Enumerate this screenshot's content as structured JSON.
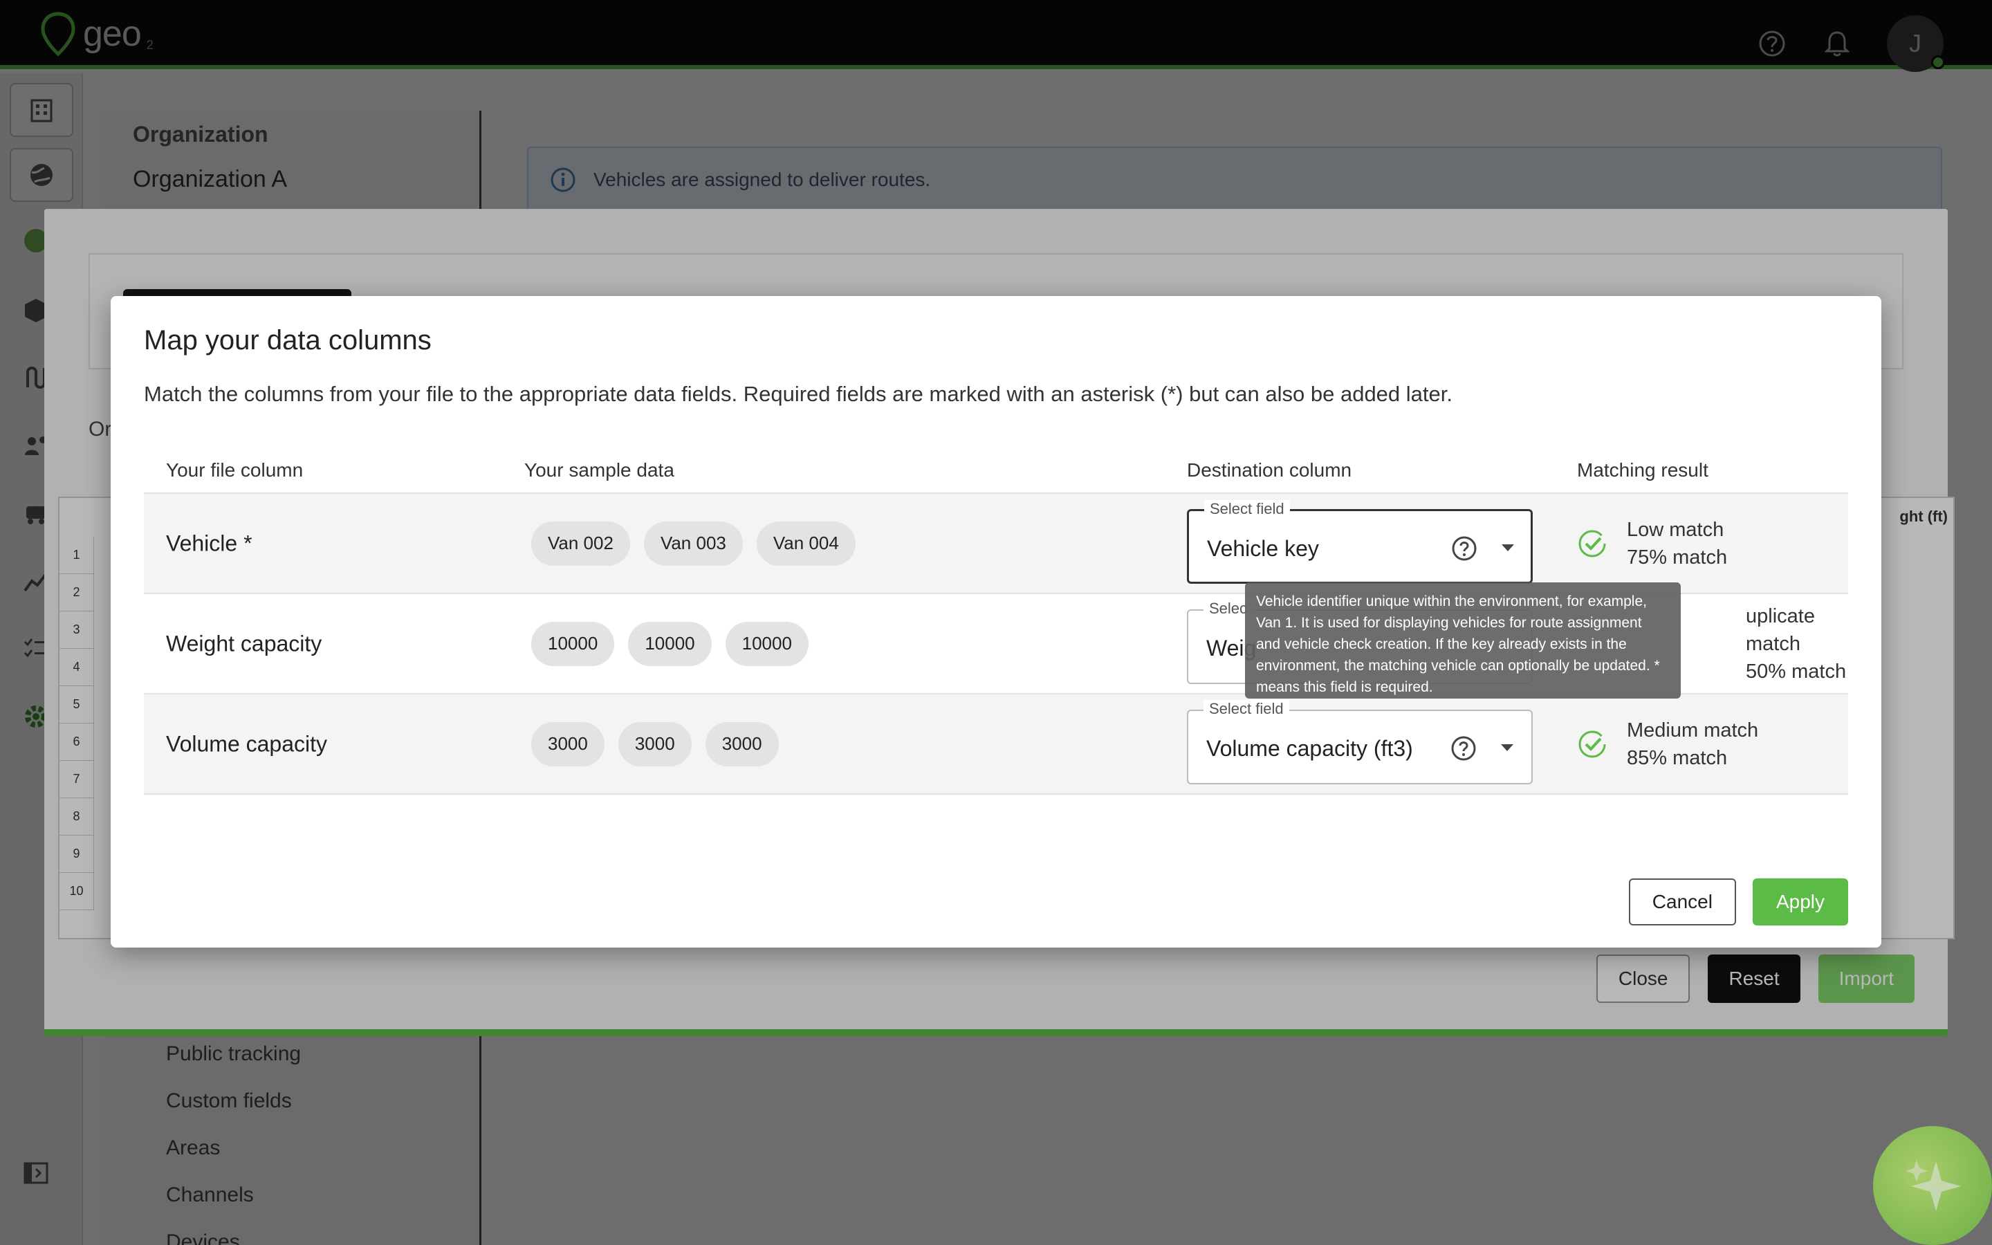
{
  "app": {
    "logo": "geo",
    "logo_sub": "2",
    "avatar_initial": "J"
  },
  "org_panel": {
    "heading": "Organization",
    "value": "Organization A",
    "links": [
      "Public tracking",
      "Custom fields",
      "Areas",
      "Channels",
      "Devices"
    ]
  },
  "info_banner": {
    "text": "Vehicles are assigned to deliver routes."
  },
  "import_modal": {
    "partial_label": "Or",
    "sheet_header_partial": "ght (ft)",
    "row_numbers": [
      "1",
      "2",
      "3",
      "4",
      "5",
      "6",
      "7",
      "8",
      "9",
      "10"
    ],
    "buttons": {
      "close": "Close",
      "reset": "Reset",
      "import": "Import"
    }
  },
  "dialog": {
    "title": "Map your data columns",
    "description": "Match the columns from your file to the appropriate data fields. Required fields are marked with an asterisk (*) but can also be added later.",
    "headers": {
      "file_column": "Your file column",
      "sample_data": "Your sample data",
      "destination": "Destination column",
      "matching": "Matching result"
    },
    "rows": [
      {
        "file_column": "Vehicle *",
        "samples": [
          "Van 002",
          "Van 003",
          "Van 004"
        ],
        "select_label": "Select field",
        "select_value": "Vehicle key",
        "match_line1": "Low match",
        "match_line2": "75% match"
      },
      {
        "file_column": "Weight capacity",
        "samples": [
          "10000",
          "10000",
          "10000"
        ],
        "select_label": "Selec",
        "select_value": "Weig",
        "match_line1": "uplicate match",
        "match_line2": "50% match"
      },
      {
        "file_column": "Volume capacity",
        "samples": [
          "3000",
          "3000",
          "3000"
        ],
        "select_label": "Select field",
        "select_value": "Volume capacity (ft3)",
        "match_line1": "Medium match",
        "match_line2": "85% match"
      }
    ],
    "tooltip": "Vehicle identifier unique within the environment, for example, Van 1. It is used for displaying vehicles for route assignment and vehicle check creation. If the key already exists in the environment, the matching vehicle can optionally be updated. * means this field is required.",
    "buttons": {
      "cancel": "Cancel",
      "apply": "Apply"
    }
  },
  "colors": {
    "brand_green": "#5bbb46",
    "topbar": "#0c0d0c"
  }
}
